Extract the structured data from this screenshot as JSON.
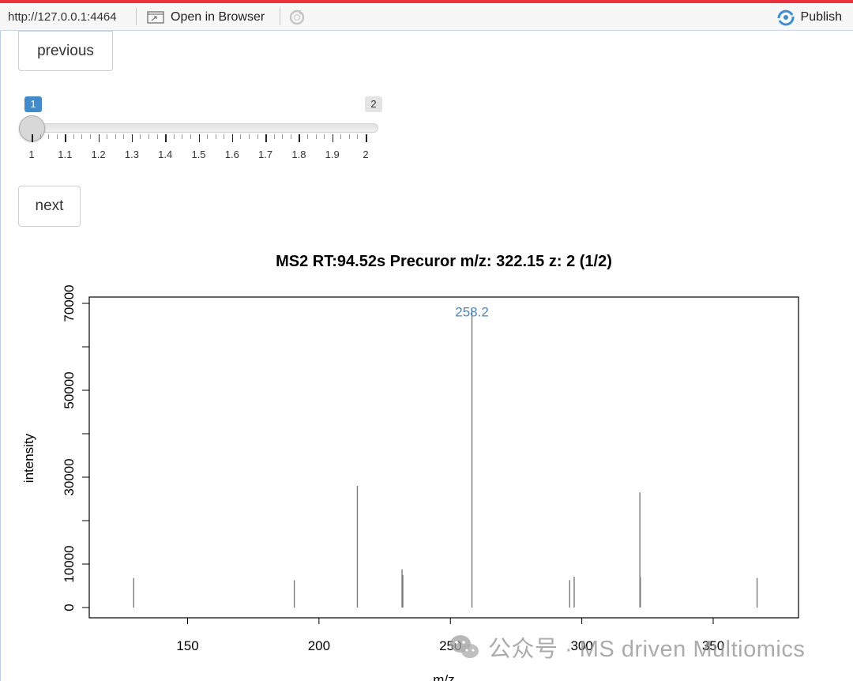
{
  "toolbar": {
    "url": "http://127.0.0.1:4464",
    "open_in_browser_label": "Open in Browser",
    "publish_label": "Publish"
  },
  "controls": {
    "previous_label": "previous",
    "next_label": "next",
    "slider": {
      "min": 1,
      "max": 2,
      "value": 1,
      "step": 0.1,
      "value_label": "1",
      "max_label": "2",
      "tick_labels": [
        "1",
        "1.1",
        "1.2",
        "1.3",
        "1.4",
        "1.5",
        "1.6",
        "1.7",
        "1.8",
        "1.9",
        "2"
      ]
    }
  },
  "chart_data": {
    "type": "bar",
    "title": "MS2 RT:94.52s Precuror m/z: 322.15 z: 2 (1/2)",
    "xlabel": "m/z",
    "ylabel": "intensity",
    "xlim": [
      113,
      384
    ],
    "ylim": [
      0,
      71000
    ],
    "x_ticks": [
      150,
      200,
      250,
      300,
      350
    ],
    "y_ticks": [
      0,
      10000,
      30000,
      50000,
      70000
    ],
    "y_minor_ticks": [
      20000,
      40000,
      60000
    ],
    "peaks": [
      {
        "mz": 129.5,
        "intensity": 6800
      },
      {
        "mz": 190.6,
        "intensity": 6300
      },
      {
        "mz": 214.6,
        "intensity": 28000
      },
      {
        "mz": 231.6,
        "intensity": 8800
      },
      {
        "mz": 231.9,
        "intensity": 7500
      },
      {
        "mz": 258.2,
        "intensity": 68500
      },
      {
        "mz": 295.4,
        "intensity": 6300
      },
      {
        "mz": 297.1,
        "intensity": 7100
      },
      {
        "mz": 322.1,
        "intensity": 26500
      },
      {
        "mz": 322.3,
        "intensity": 7000
      },
      {
        "mz": 366.7,
        "intensity": 6800
      }
    ],
    "annotation": {
      "text": "258.2",
      "mz": 258.2,
      "color": "#4a86c4"
    },
    "peak_color": "#7a7a7a"
  },
  "watermark": {
    "text": "公众号 · MS driven Multiomics"
  }
}
